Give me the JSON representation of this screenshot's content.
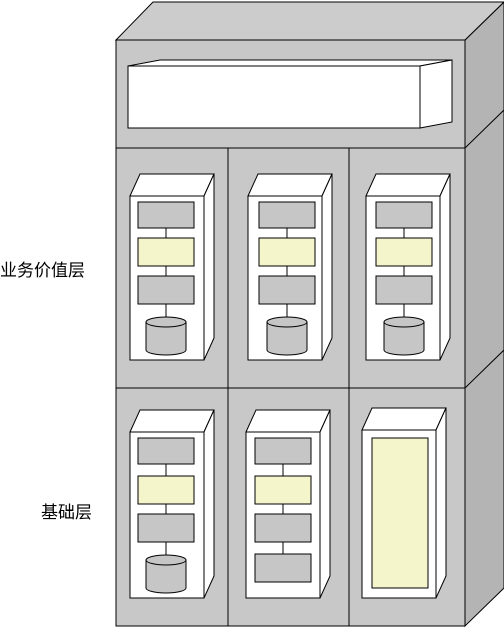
{
  "layers": {
    "business_value": "业务价值层",
    "foundation": "基础层"
  },
  "colors": {
    "cabinet_fill": "#c8c8c8",
    "cabinet_side": "#b4b4b4",
    "cabinet_top": "#cccccc",
    "module_fill": "#ffffff",
    "block_gray": "#c6c6c6",
    "block_highlight": "#f5f5cc",
    "outline": "#000000"
  },
  "icons": {
    "database": "cylinder-icon"
  }
}
